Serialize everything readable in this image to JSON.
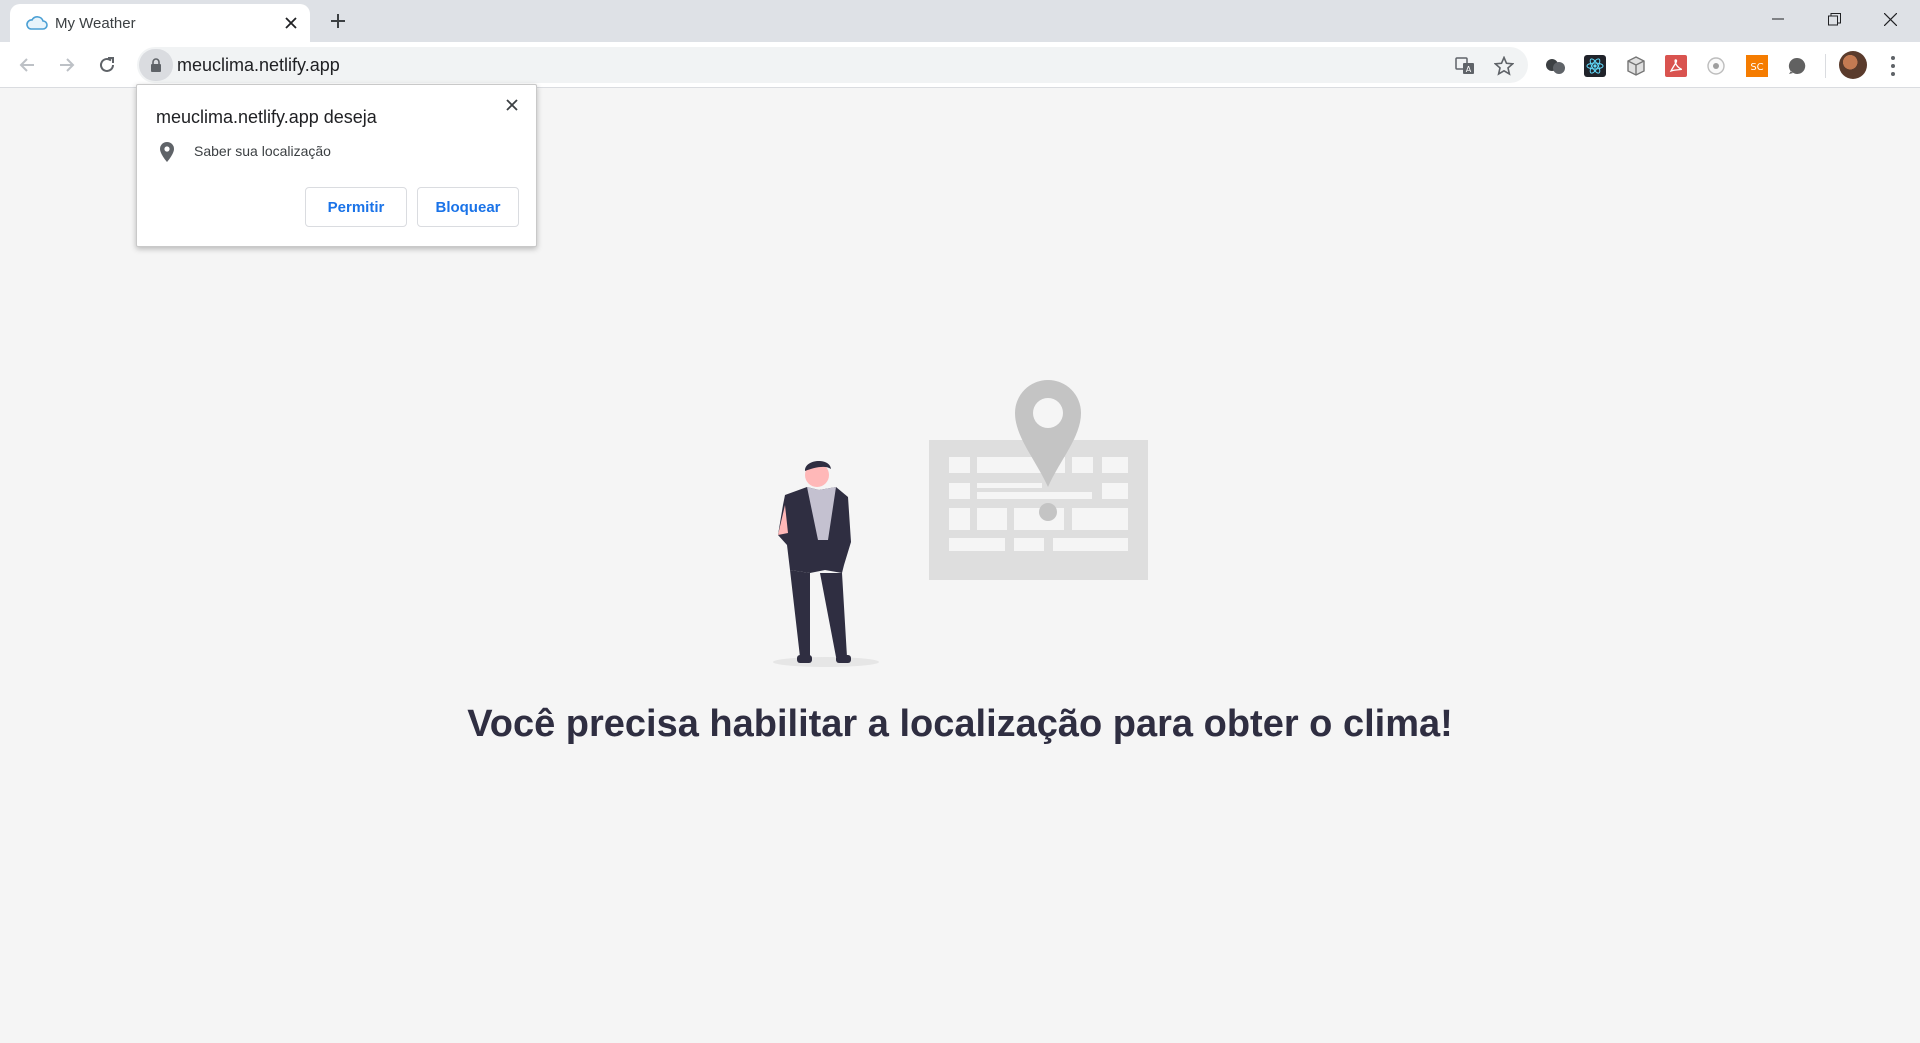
{
  "browser": {
    "tab": {
      "title": "My Weather",
      "favicon": "cloud-icon"
    },
    "address_bar": {
      "url": "meuclima.netlify.app"
    },
    "extensions": [
      "extension-icon-1",
      "react-devtools-icon",
      "extension-box-icon",
      "pdf-icon",
      "extension-icon-4",
      "sc-extension-icon",
      "extension-icon-6"
    ],
    "sc_badge": "SC"
  },
  "permission_popup": {
    "title": "meuclima.netlify.app deseja",
    "description": "Saber sua localização",
    "allow_label": "Permitir",
    "block_label": "Bloquear"
  },
  "page": {
    "message": "Você precisa habilitar a localização para obter o clima!"
  },
  "colors": {
    "accent": "#1a73e8",
    "heading": "#2f2e41",
    "illustration_gray": "#c4c4c4",
    "background": "#f5f5f5"
  }
}
